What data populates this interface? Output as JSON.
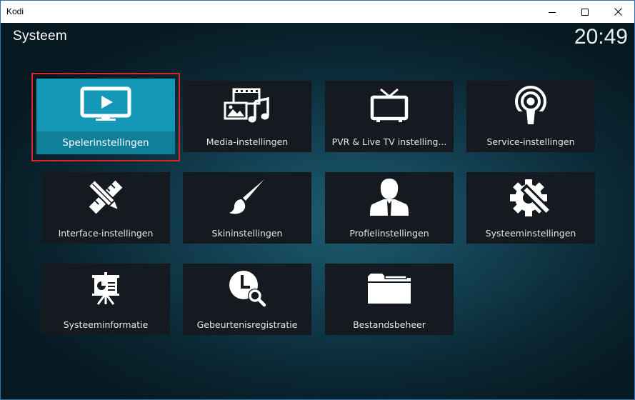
{
  "window": {
    "title": "Kodi",
    "controls": {
      "minimize": "minimize-icon",
      "maximize": "maximize-icon",
      "close": "close-icon"
    }
  },
  "header": {
    "title": "Systeem",
    "clock": "20:49"
  },
  "colors": {
    "focus_tile": "#1597b8",
    "focus_border": "#e0232a",
    "tile_bg": "#141a1f"
  },
  "tiles": [
    {
      "label": "Spelerinstellingen",
      "icon": "tv-play-icon",
      "focused": true
    },
    {
      "label": "Media-instellingen",
      "icon": "media-icon"
    },
    {
      "label": "PVR & Live TV instelling...",
      "icon": "tv-antenna-icon"
    },
    {
      "label": "Service-instellingen",
      "icon": "podcast-icon"
    },
    {
      "label": "Interface-instellingen",
      "icon": "pencil-ruler-icon"
    },
    {
      "label": "Skininstellingen",
      "icon": "paintbrush-icon"
    },
    {
      "label": "Profielinstellingen",
      "icon": "user-profile-icon"
    },
    {
      "label": "Systeeminstellingen",
      "icon": "gear-tools-icon"
    },
    {
      "label": "Systeeminformatie",
      "icon": "presentation-icon"
    },
    {
      "label": "Gebeurtenisregistratie",
      "icon": "clock-search-icon"
    },
    {
      "label": "Bestandsbeheer",
      "icon": "folder-icon"
    }
  ]
}
